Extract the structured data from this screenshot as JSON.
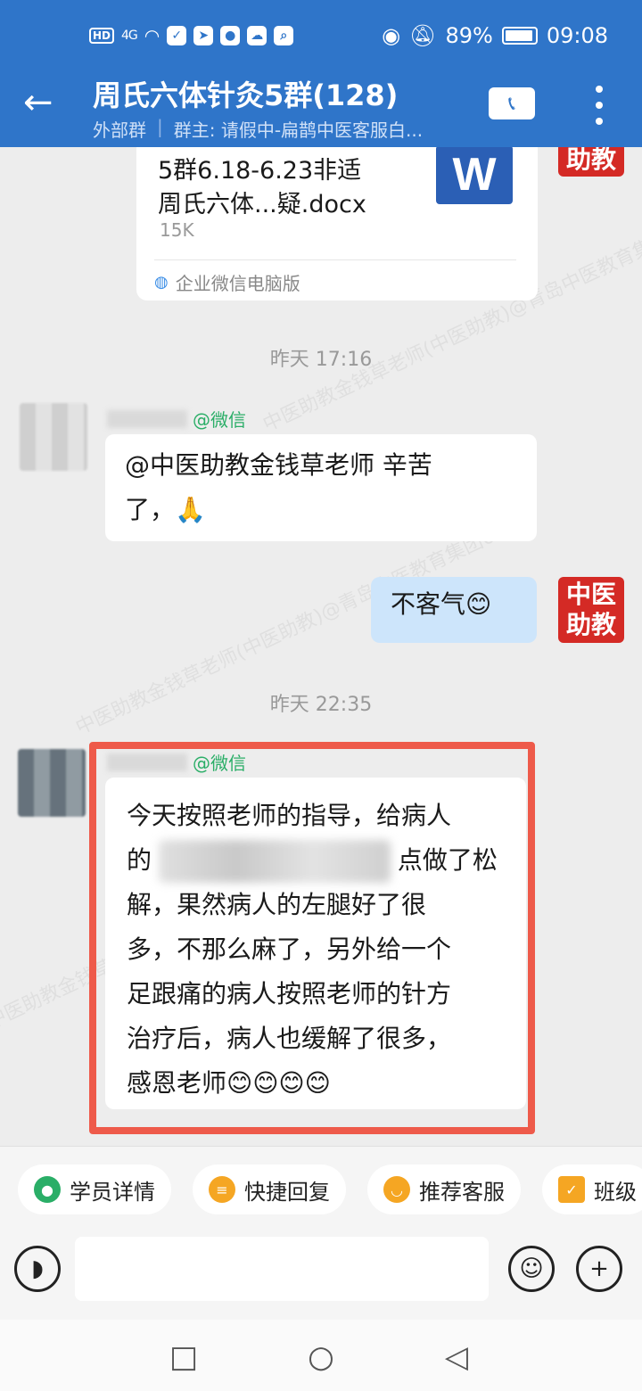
{
  "status_bar": {
    "hd": "HD",
    "signal": "4G",
    "battery": "89%",
    "time": "09:08"
  },
  "header": {
    "title": "周氏六体针灸5群(128)",
    "tag": "外部群",
    "owner": "群主: 请假中-扁鹊中医客服白..."
  },
  "messages": {
    "file": {
      "name_line1": "5群6.18-6.23非适",
      "name_line2": "周氏六体...疑.docx",
      "size": "15K",
      "icon_letter": "W",
      "source": "企业微信电脑版"
    },
    "time1": "昨天  17:16",
    "msg1": {
      "nick_suffix": "@微信",
      "text": "@中医助教金钱草老师 辛苦\n了，🙏"
    },
    "msg2": {
      "text": "不客气😊"
    },
    "time2": "昨天  22:35",
    "msg3": {
      "nick_suffix": "@微信",
      "text": "今天按照老师的指导，给病人\n的                               点做了松\n解，果然病人的左腿好了很\n多，不那么麻了，另外给一个\n足跟痛的病人按照老师的针方\n治疗后，病人也缓解了很多，\n感恩老师😊😊😊😊"
    }
  },
  "badge": {
    "line1": "中医",
    "line2": "助教"
  },
  "watermark": "中医助教金钱草老师(中医助教)@青岛中医教育集团653",
  "quick_actions": [
    {
      "label": "学员详情",
      "icon": "person-icon",
      "color": "#2aae67"
    },
    {
      "label": "快捷回复",
      "icon": "chat-icon",
      "color": "#f5a623"
    },
    {
      "label": "推荐客服",
      "icon": "service-icon",
      "color": "#f5a623"
    },
    {
      "label": "班级",
      "icon": "doc-icon",
      "color": "#f5a623"
    }
  ],
  "input": {
    "placeholder": ""
  }
}
